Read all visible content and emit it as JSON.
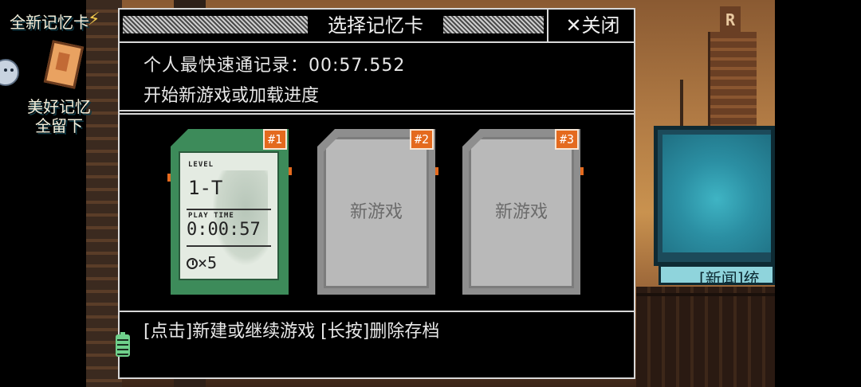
{
  "dialog": {
    "title": "选择记忆卡",
    "close_label": "关闭",
    "close_icon": "✕",
    "best_record": "个人最快速通记录：00:57.552",
    "subtitle": "开始新游戏或加载进度",
    "footer_hint": "[点击]新建或继续游戏 [长按]删除存档"
  },
  "slots": [
    {
      "badge": "#1",
      "level_label": "LEVEL",
      "level": "1-T",
      "playtime_label": "PLAY TIME",
      "playtime": "0:00:57",
      "rewinds": "×5"
    },
    {
      "badge": "#2",
      "label": "新游戏"
    },
    {
      "badge": "#3",
      "label": "新游戏"
    }
  ],
  "billboard": {
    "title": "全新记忆卡",
    "line1": "美好记忆",
    "line2": "全留下",
    "news": "[新闻]统"
  },
  "background": {
    "tower_letter": "R"
  },
  "colors": {
    "panel_bg": "#000000",
    "panel_border": "#d8d8d8",
    "active_card": "#3d8b5a",
    "empty_card": "#8e8e8e",
    "badge": "#e46a1e",
    "billboard": "#2b8fa3"
  }
}
